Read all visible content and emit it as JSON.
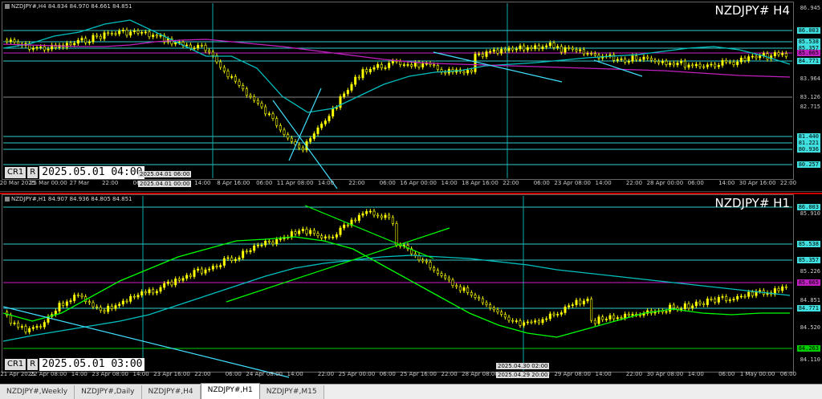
{
  "h4": {
    "header": "NZDJPY#,H4  84.834 84.970 84.661 84.851",
    "symbol": "NZDJPY# H4",
    "cr_label": "CR1",
    "r_label": "R",
    "cursor_time": "2025.05.01 04:00",
    "cursor_x_label1": "2025.04.01 06:00",
    "cursor_x_label2": "2025.04.01 00:00",
    "y_labels": [
      "86.945",
      "86.003",
      "85.538",
      "85.357",
      "85.065",
      "84.771",
      "83.964",
      "83.126",
      "82.715",
      "81.440",
      "81.221",
      "80.936",
      "80.257"
    ],
    "x_labels": [
      "20 Mar 2025",
      "25 Mar 00:00",
      "27 Mar",
      "22:00",
      "06:00",
      "4 Apr 00:00",
      "14:00",
      "8 Apr 16:00",
      "06:00",
      "11 Apr 08:00",
      "14:00",
      "22:00",
      "06:00",
      "16 Apr 00:00",
      "14:00",
      "18 Apr 16:00",
      "22:00",
      "06:00",
      "23 Apr 08:00",
      "14:00",
      "22:00",
      "28 Apr 00:00",
      "06:00",
      "14:00",
      "30 Apr 16:00",
      "22:00"
    ]
  },
  "h1": {
    "header": "NZDJPY#,H1  84.907 84.936 84.805 84.851",
    "symbol": "NZDJPY# H1",
    "cr_label": "CR1",
    "r_label": "R",
    "cursor_time": "2025.05.01 03:00",
    "cursor_x_label1": "2025.04.30 02:00",
    "cursor_x_label2": "2025.04.29 20:00",
    "y_labels": [
      "86.003",
      "85.910",
      "85.538",
      "85.357",
      "85.226",
      "85.065",
      "84.851",
      "84.771",
      "84.520",
      "84.263",
      "84.110"
    ],
    "x_labels": [
      "21 Apr 2025",
      "22 Apr 08:00",
      "14:00",
      "23 Apr 08:00",
      "14:00",
      "23 Apr 16:00",
      "22:00",
      "06:00",
      "24 Apr 08:00",
      "14:00",
      "22:00",
      "25 Apr 00:00",
      "06:00",
      "25 Apr 16:00",
      "22:00",
      "28 Apr 08:00",
      "14:00",
      "22:00",
      "29 Apr 08:00",
      "14:00",
      "22:00",
      "30 Apr 08:00",
      "14:00",
      "06:00",
      "1 May 00:00",
      "06:00"
    ]
  },
  "tabs": [
    "NZDJPY#,Weekly",
    "NZDJPY#,Daily",
    "NZDJPY#,H4",
    "NZDJPY#,H1",
    "NZDJPY#,M15"
  ],
  "active_tab": "NZDJPY#,H1",
  "colors": {
    "candle": "#ffff00",
    "ma_fast": "#00c0c0",
    "ma_slow": "#c020c0",
    "ma_green": "#00ff00",
    "trend": "#40e0ff",
    "bg": "#000000"
  }
}
